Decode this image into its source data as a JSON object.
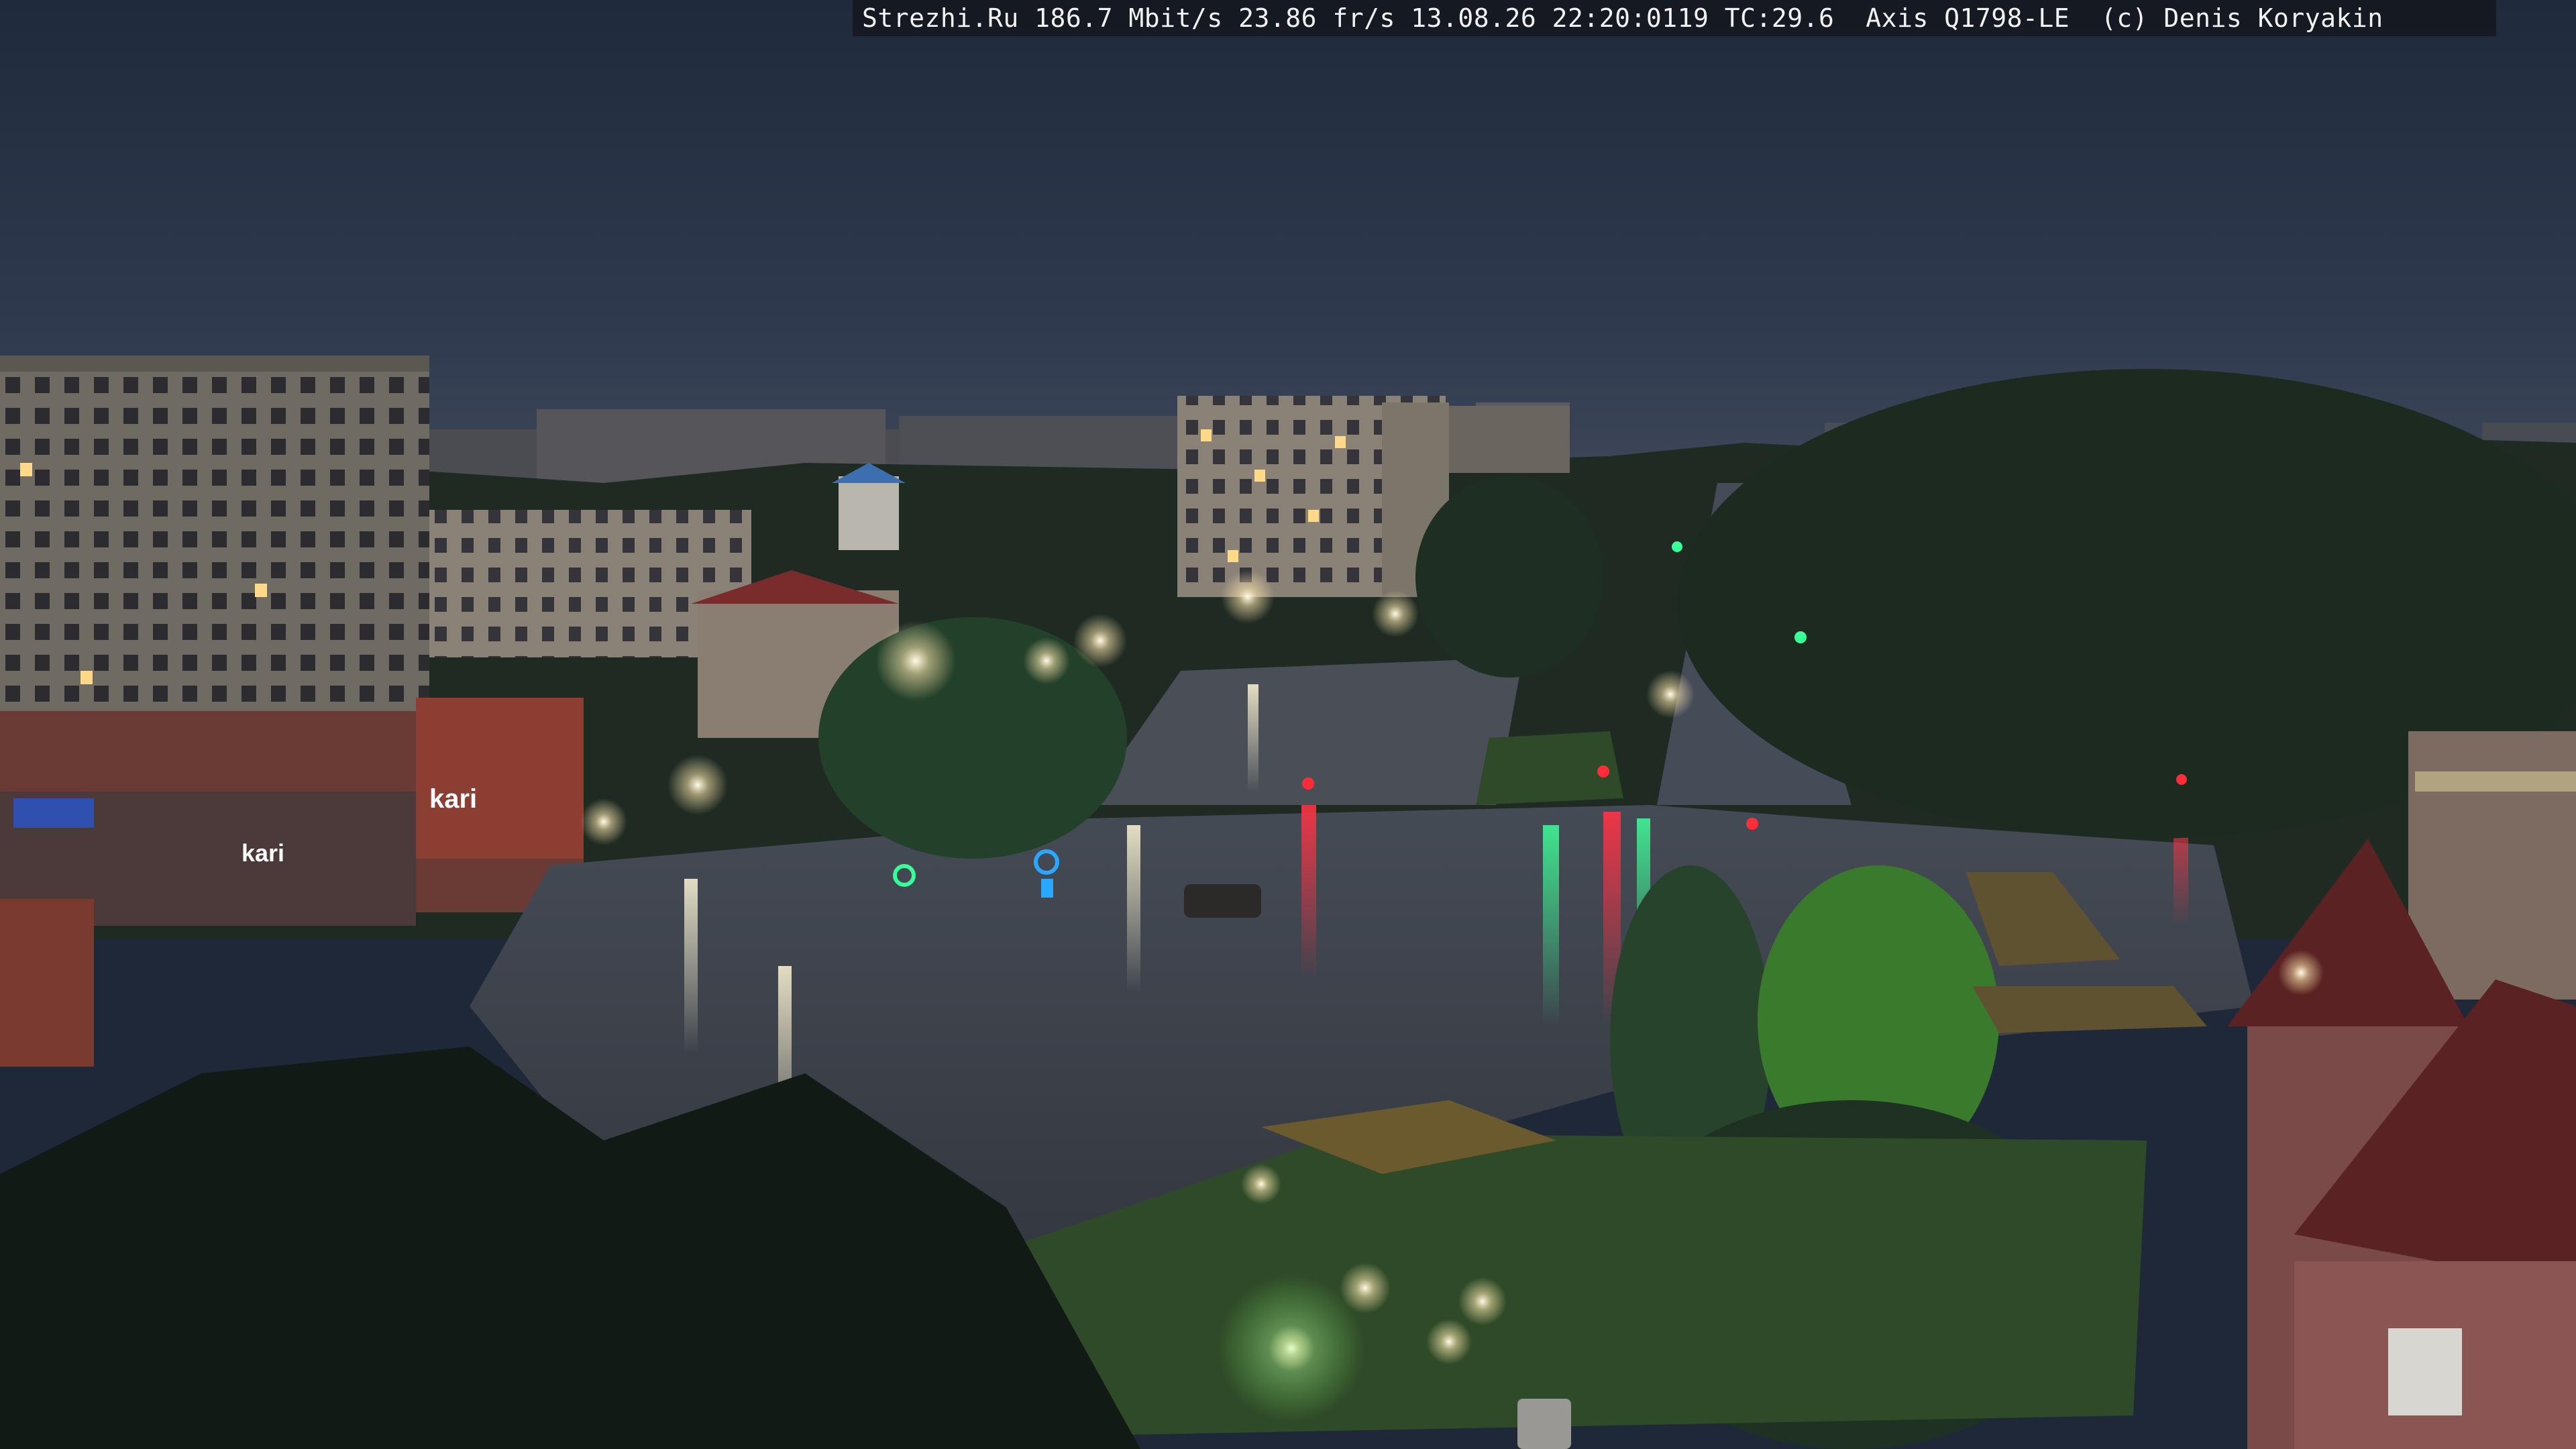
{
  "overlay": {
    "caption": "Strezhi.Ru 186.7 Mbit/s 23.86 fr/s 13.08.26 22:20:0119 TC:29.6  Axis Q1798-LE  (c) Denis Koryakin"
  },
  "signage": {
    "store_sign_1": "kari",
    "store_sign_2": "kari"
  },
  "colors": {
    "sky_top": "#222c3e",
    "sky_horizon": "#3a4458",
    "foliage": "#1d2a1f",
    "wet_asphalt": "#3b4049",
    "lamp_glow": "#fff6d8",
    "signal_red": "#ff2d3a",
    "signal_green": "#38ff9a",
    "neon_blue": "#2aa8ff"
  }
}
